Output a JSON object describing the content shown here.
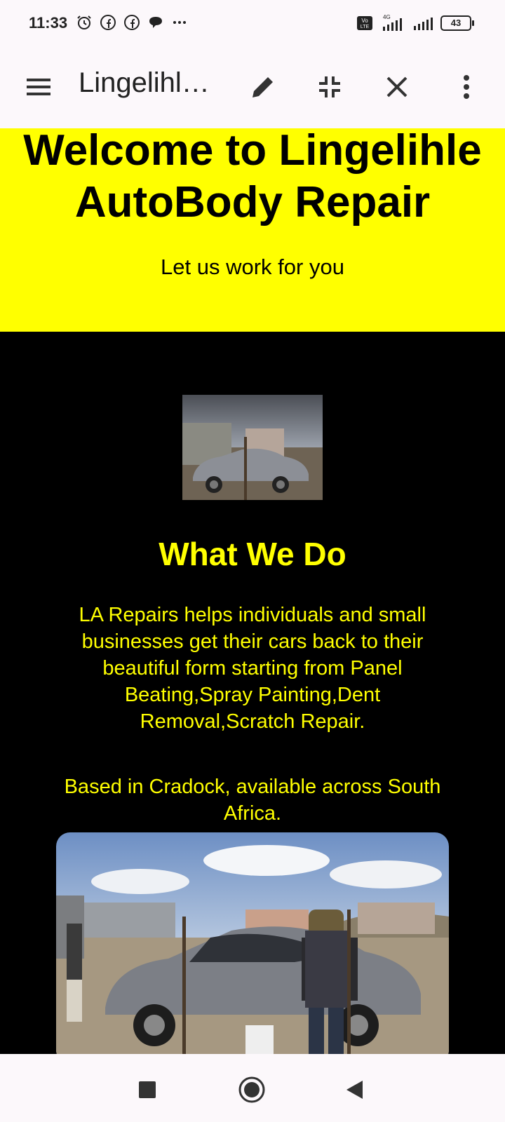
{
  "status_bar": {
    "time": "11:33",
    "left_icons": [
      "alarm-icon",
      "facebook-icon",
      "facebook-icon",
      "chat-bubble-icon",
      "more-dots-icon"
    ],
    "network_label": "4G",
    "volte_label": "Vo LTE",
    "battery": "43"
  },
  "toolbar": {
    "title": "Lingelihl…",
    "icons": [
      "menu-icon",
      "edit-icon",
      "minimize-icon",
      "close-icon",
      "more-vert-icon"
    ]
  },
  "hero": {
    "title": "Welcome to Lingelihle AutoBody Repair",
    "subtitle": "Let us work for you",
    "background": "#ffff00"
  },
  "main": {
    "heading": "What We Do",
    "description": "LA Repairs helps individuals and small businesses get their cars back to their beautiful form starting from Panel Beating,Spray Painting,Dent Removal,Scratch Repair.",
    "location": "Based in Cradock, available across South Africa.",
    "text_color": "#ffff00",
    "background": "#000000"
  },
  "nav_bar": {
    "icons": [
      "recents-square-icon",
      "home-circle-icon",
      "back-triangle-icon"
    ]
  }
}
